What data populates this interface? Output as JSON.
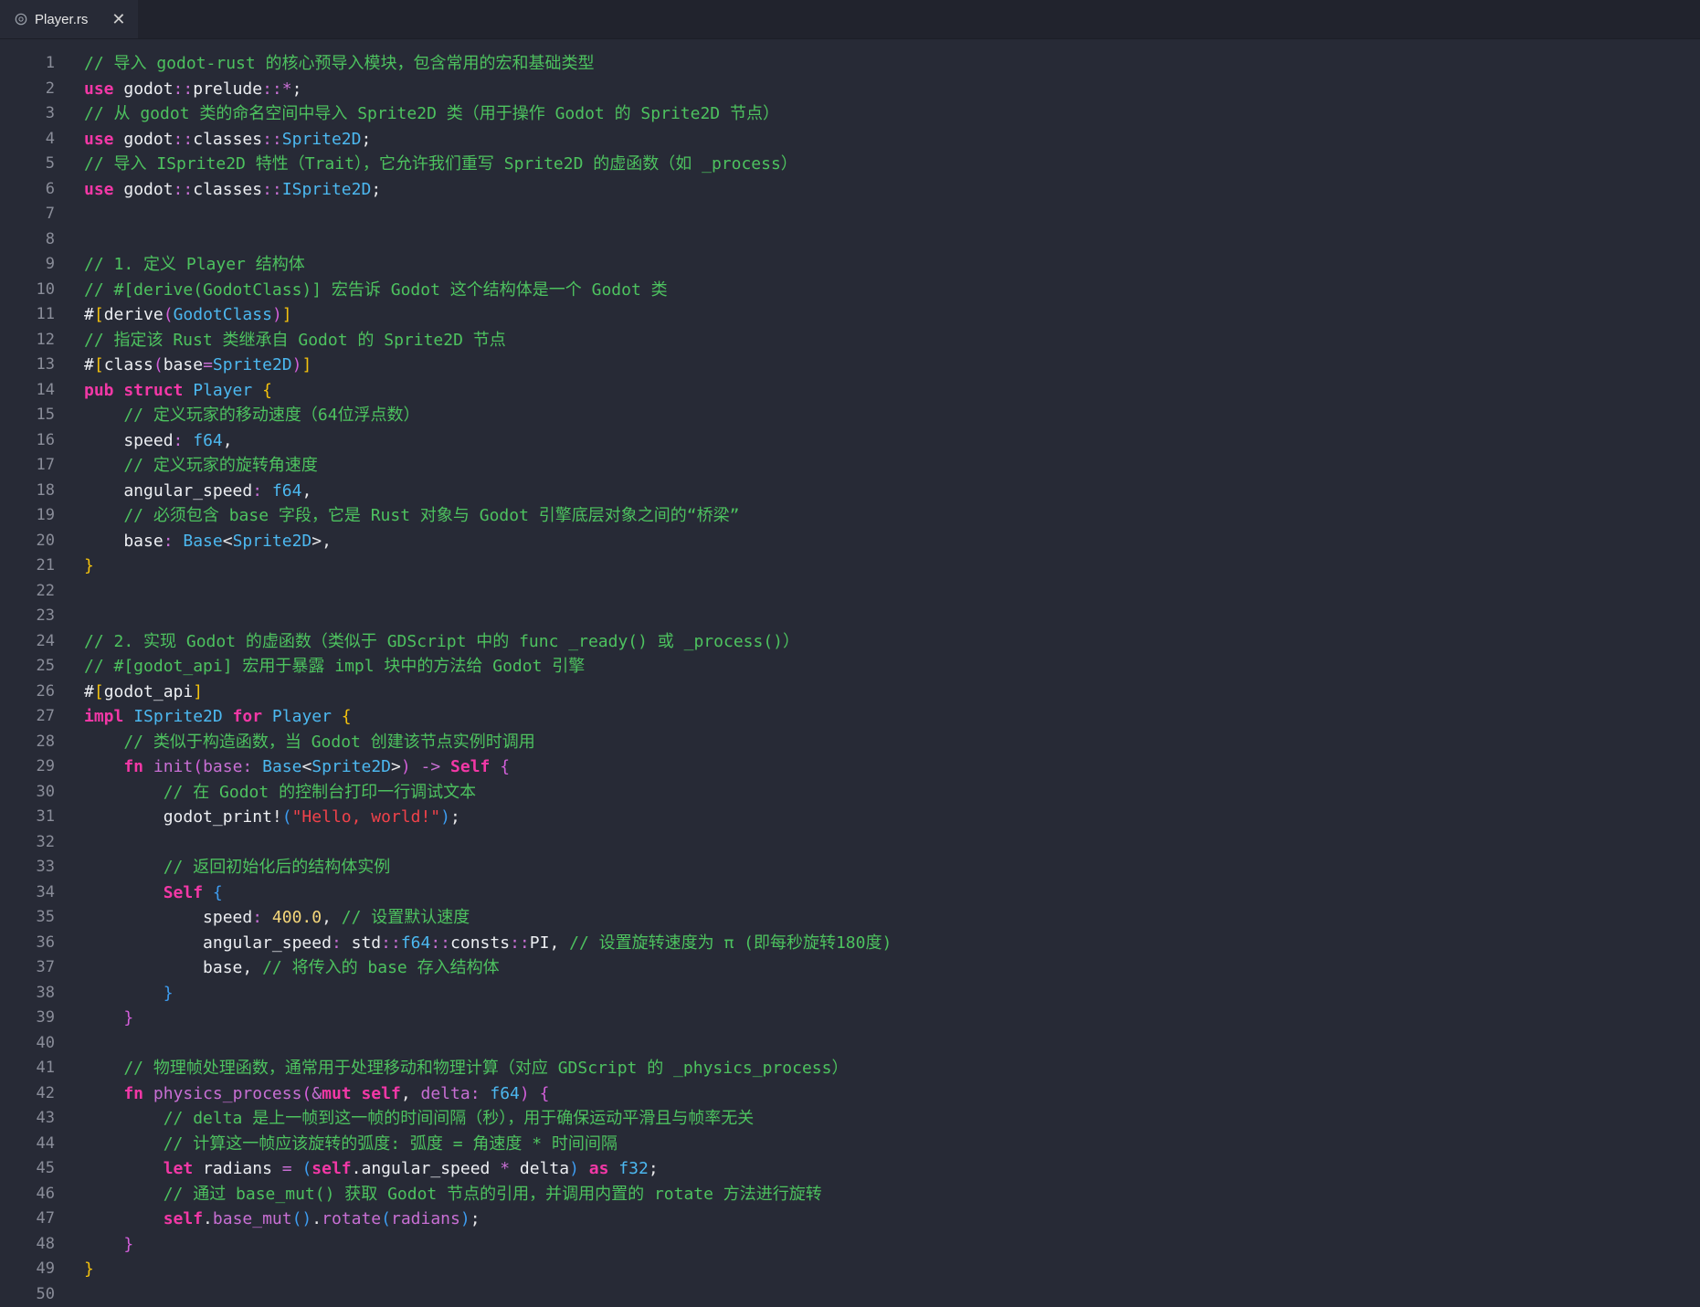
{
  "tab": {
    "title": "Player.rs",
    "icon": "rust-file-icon",
    "close_glyph": "✕"
  },
  "lines": [
    [
      [
        "cm",
        "// 导入 godot-rust 的核心预导入模块，包含常用的宏和基础类型"
      ]
    ],
    [
      [
        "kw",
        "use"
      ],
      [
        "id",
        " godot"
      ],
      [
        "op",
        "::"
      ],
      [
        "id",
        "prelude"
      ],
      [
        "op",
        "::*"
      ],
      [
        "pn",
        ";"
      ]
    ],
    [
      [
        "cm",
        "// 从 godot 类的命名空间中导入 Sprite2D 类（用于操作 Godot 的 Sprite2D 节点）"
      ]
    ],
    [
      [
        "kw",
        "use"
      ],
      [
        "id",
        " godot"
      ],
      [
        "op",
        "::"
      ],
      [
        "id",
        "classes"
      ],
      [
        "op",
        "::"
      ],
      [
        "ty",
        "Sprite2D"
      ],
      [
        "pn",
        ";"
      ]
    ],
    [
      [
        "cm",
        "// 导入 ISprite2D 特性（Trait），它允许我们重写 Sprite2D 的虚函数（如 _process）"
      ]
    ],
    [
      [
        "kw",
        "use"
      ],
      [
        "id",
        " godot"
      ],
      [
        "op",
        "::"
      ],
      [
        "id",
        "classes"
      ],
      [
        "op",
        "::"
      ],
      [
        "ty",
        "ISprite2D"
      ],
      [
        "pn",
        ";"
      ]
    ],
    [],
    [],
    [
      [
        "cm",
        "// 1. 定义 Player 结构体"
      ]
    ],
    [
      [
        "cm",
        "// #[derive(GodotClass)] 宏告诉 Godot 这个结构体是一个 Godot 类"
      ]
    ],
    [
      [
        "id",
        "#"
      ],
      [
        "br1",
        "["
      ],
      [
        "id",
        "derive"
      ],
      [
        "br2",
        "("
      ],
      [
        "ty",
        "GodotClass"
      ],
      [
        "br2",
        ")"
      ],
      [
        "br1",
        "]"
      ]
    ],
    [
      [
        "cm",
        "// 指定该 Rust 类继承自 Godot 的 Sprite2D 节点"
      ]
    ],
    [
      [
        "id",
        "#"
      ],
      [
        "br1",
        "["
      ],
      [
        "id",
        "class"
      ],
      [
        "br2",
        "("
      ],
      [
        "id",
        "base"
      ],
      [
        "op",
        "="
      ],
      [
        "ty",
        "Sprite2D"
      ],
      [
        "br2",
        ")"
      ],
      [
        "br1",
        "]"
      ]
    ],
    [
      [
        "kw",
        "pub struct"
      ],
      [
        "ty",
        " Player"
      ],
      [
        "br1",
        " {"
      ]
    ],
    [
      [
        "cm",
        "    // 定义玩家的移动速度（64位浮点数）"
      ]
    ],
    [
      [
        "id",
        "    speed"
      ],
      [
        "op",
        ":"
      ],
      [
        "ty",
        " f64"
      ],
      [
        "pn",
        ","
      ]
    ],
    [
      [
        "cm",
        "    // 定义玩家的旋转角速度"
      ]
    ],
    [
      [
        "id",
        "    angular_speed"
      ],
      [
        "op",
        ":"
      ],
      [
        "ty",
        " f64"
      ],
      [
        "pn",
        ","
      ]
    ],
    [
      [
        "cm",
        "    // 必须包含 base 字段，它是 Rust 对象与 Godot 引擎底层对象之间的“桥梁”"
      ]
    ],
    [
      [
        "id",
        "    base"
      ],
      [
        "op",
        ":"
      ],
      [
        "ty",
        " Base"
      ],
      [
        "pn",
        "<"
      ],
      [
        "ty",
        "Sprite2D"
      ],
      [
        "pn",
        ">,"
      ]
    ],
    [
      [
        "br1",
        "}"
      ]
    ],
    [],
    [],
    [
      [
        "cm",
        "// 2. 实现 Godot 的虚函数（类似于 GDScript 中的 func _ready() 或 _process()）"
      ]
    ],
    [
      [
        "cm",
        "// #[godot_api] 宏用于暴露 impl 块中的方法给 Godot 引擎"
      ]
    ],
    [
      [
        "id",
        "#"
      ],
      [
        "br1",
        "["
      ],
      [
        "id",
        "godot_api"
      ],
      [
        "br1",
        "]"
      ]
    ],
    [
      [
        "kw",
        "impl"
      ],
      [
        "ty",
        " ISprite2D"
      ],
      [
        "kw",
        " for"
      ],
      [
        "ty",
        " Player"
      ],
      [
        "br1",
        " {"
      ]
    ],
    [
      [
        "cm",
        "    // 类似于构造函数，当 Godot 创建该节点实例时调用"
      ]
    ],
    [
      [
        "kw",
        "    fn"
      ],
      [
        "fn",
        " init"
      ],
      [
        "br2",
        "("
      ],
      [
        "fn",
        "base"
      ],
      [
        "op",
        ":"
      ],
      [
        "ty",
        " Base"
      ],
      [
        "pn",
        "<"
      ],
      [
        "ty",
        "Sprite2D"
      ],
      [
        "pn",
        ">"
      ],
      [
        "br2",
        ")"
      ],
      [
        "op",
        " ->"
      ],
      [
        "kw",
        " Self"
      ],
      [
        "br2",
        " {"
      ]
    ],
    [
      [
        "cm",
        "        // 在 Godot 的控制台打印一行调试文本"
      ]
    ],
    [
      [
        "id",
        "        godot_print"
      ],
      [
        "pn",
        "!"
      ],
      [
        "br3",
        "("
      ],
      [
        "str",
        "\"Hello, world!\""
      ],
      [
        "br3",
        ")"
      ],
      [
        "pn",
        ";"
      ]
    ],
    [],
    [
      [
        "cm",
        "        // 返回初始化后的结构体实例"
      ]
    ],
    [
      [
        "kw",
        "        Self"
      ],
      [
        "br3",
        " {"
      ]
    ],
    [
      [
        "id",
        "            speed"
      ],
      [
        "op",
        ":"
      ],
      [
        "num",
        " 400.0"
      ],
      [
        "pn",
        ","
      ],
      [
        "cm",
        " // 设置默认速度"
      ]
    ],
    [
      [
        "id",
        "            angular_speed"
      ],
      [
        "op",
        ":"
      ],
      [
        "id",
        " std"
      ],
      [
        "op",
        "::"
      ],
      [
        "ty",
        "f64"
      ],
      [
        "op",
        "::"
      ],
      [
        "id",
        "consts"
      ],
      [
        "op",
        "::"
      ],
      [
        "id",
        "PI"
      ],
      [
        "pn",
        ","
      ],
      [
        "cm",
        " // 设置旋转速度为 π (即每秒旋转180度)"
      ]
    ],
    [
      [
        "id",
        "            base"
      ],
      [
        "pn",
        ","
      ],
      [
        "cm",
        " // 将传入的 base 存入结构体"
      ]
    ],
    [
      [
        "br3",
        "        }"
      ]
    ],
    [
      [
        "br2",
        "    }"
      ]
    ],
    [],
    [
      [
        "cm",
        "    // 物理帧处理函数，通常用于处理移动和物理计算（对应 GDScript 的 _physics_process）"
      ]
    ],
    [
      [
        "kw",
        "    fn"
      ],
      [
        "fn",
        " physics_process"
      ],
      [
        "br2",
        "("
      ],
      [
        "op",
        "&"
      ],
      [
        "kw",
        "mut self"
      ],
      [
        "pn",
        ","
      ],
      [
        "fn",
        " delta"
      ],
      [
        "op",
        ":"
      ],
      [
        "ty",
        " f64"
      ],
      [
        "br2",
        ")"
      ],
      [
        "br2",
        " {"
      ]
    ],
    [
      [
        "cm",
        "        // delta 是上一帧到这一帧的时间间隔（秒），用于确保运动平滑且与帧率无关"
      ]
    ],
    [
      [
        "cm",
        "        // 计算这一帧应该旋转的弧度: 弧度 = 角速度 * 时间间隔"
      ]
    ],
    [
      [
        "kw",
        "        let"
      ],
      [
        "id",
        " radians"
      ],
      [
        "op",
        " ="
      ],
      [
        "br3",
        " ("
      ],
      [
        "self",
        "self"
      ],
      [
        "pn",
        "."
      ],
      [
        "id",
        "angular_speed"
      ],
      [
        "op",
        " *"
      ],
      [
        "id",
        " delta"
      ],
      [
        "br3",
        ")"
      ],
      [
        "kw",
        " as"
      ],
      [
        "ty",
        " f32"
      ],
      [
        "pn",
        ";"
      ]
    ],
    [
      [
        "cm",
        "        // 通过 base_mut() 获取 Godot 节点的引用，并调用内置的 rotate 方法进行旋转"
      ]
    ],
    [
      [
        "self",
        "        self"
      ],
      [
        "pn",
        "."
      ],
      [
        "fn",
        "base_mut"
      ],
      [
        "br3",
        "()"
      ],
      [
        "pn",
        "."
      ],
      [
        "fn",
        "rotate"
      ],
      [
        "br3",
        "("
      ],
      [
        "fn",
        "radians"
      ],
      [
        "br3",
        ")"
      ],
      [
        "pn",
        ";"
      ]
    ],
    [
      [
        "br2",
        "    }"
      ]
    ],
    [
      [
        "br1",
        "}"
      ]
    ],
    []
  ]
}
